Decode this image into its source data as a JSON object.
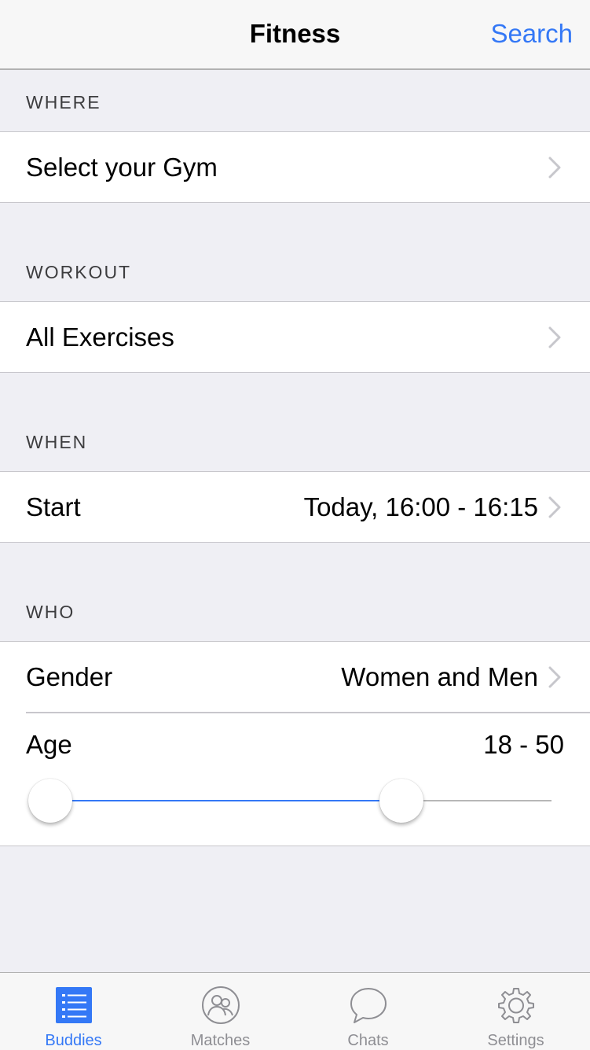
{
  "navbar": {
    "title": "Fitness",
    "search_label": "Search"
  },
  "sections": {
    "where": {
      "header": "WHERE",
      "row_label": "Select your Gym"
    },
    "workout": {
      "header": "WORKOUT",
      "row_label": "All Exercises"
    },
    "when": {
      "header": "WHEN",
      "row_label": "Start",
      "row_value": "Today, 16:00 - 16:15"
    },
    "who": {
      "header": "WHO",
      "gender_label": "Gender",
      "gender_value": "Women and Men",
      "age_label": "Age",
      "age_value": "18 - 50",
      "age_slider": {
        "min_fraction": 0.0,
        "max_fraction": 0.7
      }
    }
  },
  "tabbar": {
    "tabs": [
      {
        "label": "Buddies",
        "icon": "list-icon",
        "active": true
      },
      {
        "label": "Matches",
        "icon": "people-icon",
        "active": false
      },
      {
        "label": "Chats",
        "icon": "chat-bubble-icon",
        "active": false
      },
      {
        "label": "Settings",
        "icon": "gear-icon",
        "active": false
      }
    ]
  },
  "colors": {
    "accent": "#3478f6",
    "background": "#efeff4",
    "inactive": "#8e8e93"
  }
}
